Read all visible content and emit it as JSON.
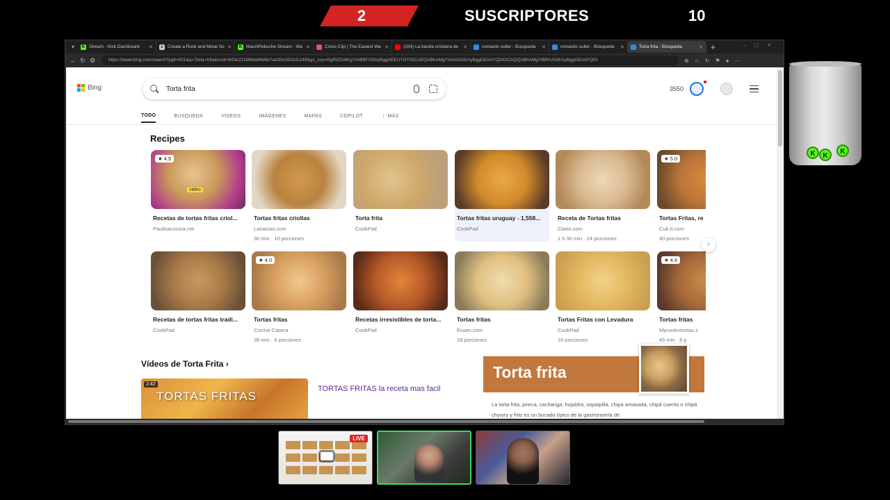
{
  "overlay": {
    "badge_number": "2",
    "subs_label": "SUSCRIPTORES",
    "subs_count": "10",
    "live_label": "LIVE"
  },
  "browser": {
    "tabs": [
      {
        "label": "Stream - Kick Dashboard",
        "color": "#53fc18",
        "glyph": "K"
      },
      {
        "label": "Create a Rock and Metal So",
        "color": "#cccccc",
        "glyph": "c"
      },
      {
        "label": "MauriiPekuche Stream - Wa",
        "color": "#53fc18",
        "glyph": "K"
      },
      {
        "label": "Cross Clip | The Easiest Wa",
        "color": "#e24aa0",
        "glyph": ""
      },
      {
        "label": "(204) La banda cristiana de",
        "color": "#ff0000",
        "glyph": ""
      },
      {
        "label": "romasito suller - Búsqueda",
        "color": "#2a8ce8",
        "glyph": ""
      },
      {
        "label": "romasito suller - Búsqueda",
        "color": "#2a8ce8",
        "glyph": ""
      },
      {
        "label": "Torta frita - Búsqueda",
        "color": "#2a8ce8",
        "glyph": ""
      }
    ],
    "url": "https://www.bing.com/search?pglt=931&q=Torta+frita&cvid=943e221896dd4fd6b7ad35c0833d1249&gs_lcrp=EgRlZGdlKgYIABBFGDkyBggAEEUYOTIGCAEQABhAMgYIAhAAGEAyBggDEAAYQDIGCAQQABhAMgYIBRAAGEAyBggGEAAYQDI"
  },
  "bing": {
    "logo_text": "Bing",
    "search": {
      "value": "Torta frita",
      "placeholder": ""
    },
    "points": "3550",
    "nav_tabs": [
      "TODO",
      "BÚSQUEDA",
      "VÍDEOS",
      "IMÁGENES",
      "MAPAS",
      "COPILOT",
      "⋮ MÁS"
    ],
    "recipes_title": "Recipes",
    "recipes_row1": [
      {
        "title": "Recetas de tortas fritas criol...",
        "source": "Paulinacocina.net",
        "meta": "",
        "rating": "★ 4.5",
        "video": "video"
      },
      {
        "title": "Tortas fritas criollas",
        "source": "Lanacion.com",
        "meta": "30 min · 10 porciones",
        "rating": "",
        "video": ""
      },
      {
        "title": "Torta frita",
        "source": "CookPad",
        "meta": "",
        "rating": "",
        "video": ""
      },
      {
        "title": "Tortas fritas uruguay - 1,558...",
        "source": "CookPad",
        "meta": "",
        "rating": "",
        "video": ""
      },
      {
        "title": "Receta de Tortas fritas",
        "source": "Clarin.com",
        "meta": "1 h 30 min · 24 porciones",
        "rating": "",
        "video": ""
      },
      {
        "title": "Tortas Fritas, re",
        "source": "Cuk-it.com",
        "meta": "40 porciones",
        "rating": "★ 5.0",
        "video": ""
      }
    ],
    "recipes_row2": [
      {
        "title": "Recetas de tortas fritas tradi...",
        "source": "CookPad",
        "meta": "",
        "rating": ""
      },
      {
        "title": "Tortas fritas",
        "source": "Cocina Casera",
        "meta": "35 min · 4 porciones",
        "rating": "★ 4.0"
      },
      {
        "title": "Recetas irresistibles de torta...",
        "source": "CookPad",
        "meta": "",
        "rating": ""
      },
      {
        "title": "Tortas fritas",
        "source": "Essen.com",
        "meta": "18 porciones",
        "rating": ""
      },
      {
        "title": "Tortas Fritas con Levadura",
        "source": "CookPad",
        "meta": "10 porciones",
        "rating": ""
      },
      {
        "title": "Tortas fritas",
        "source": "Mycookrecetas.c",
        "meta": "45 min · 8 p",
        "rating": "★ 4.6"
      }
    ],
    "videos_title": "Vídeos de Torta Frita ›",
    "video": {
      "duration": "2:42",
      "thumb_text": "TORTAS FRITAS",
      "title": "TORTAS FRITAS la receta mas facil"
    },
    "knowledge": {
      "title": "Torta frita",
      "description": "La torta frita, pireca, cachanga, hojaldra, sopaipilla, chipa amasada, chipá cuerito o chipá chyryry y frito es un bocado típico de la gastronomía de"
    }
  },
  "colors": {
    "accent_red": "#d42323",
    "kick_green": "#53fc18",
    "knowledge_header": "#c2783c",
    "video_link": "#5b2d8c"
  }
}
